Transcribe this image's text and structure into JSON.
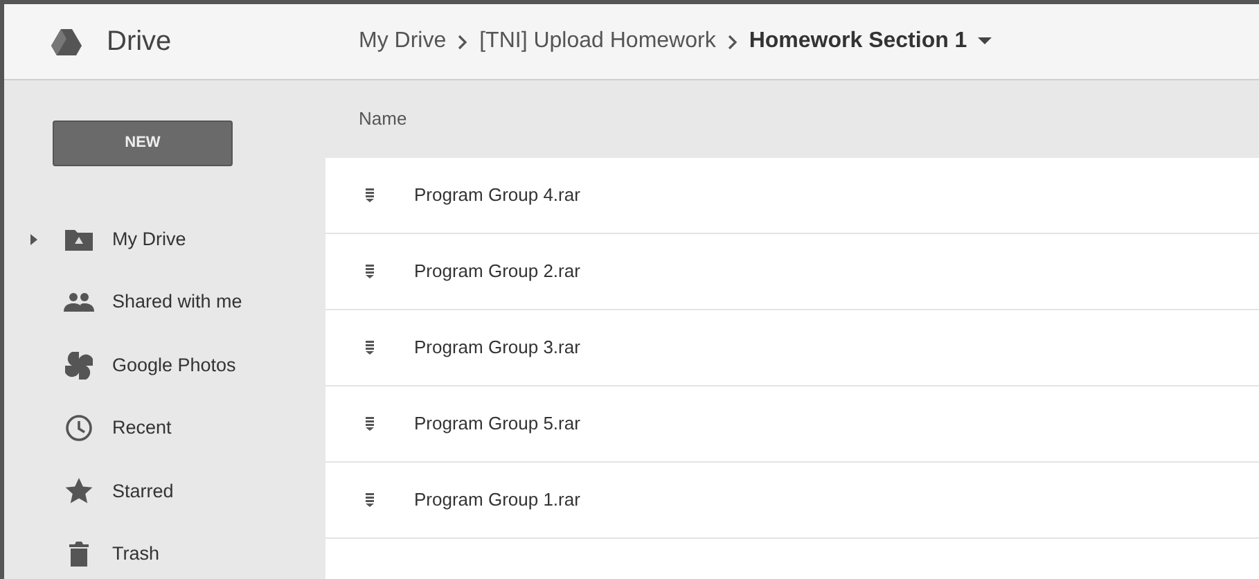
{
  "app": {
    "title": "Drive"
  },
  "breadcrumbs": [
    {
      "label": "My Drive",
      "current": false
    },
    {
      "label": "[TNI] Upload Homework",
      "current": false
    },
    {
      "label": "Homework Section 1",
      "current": true
    }
  ],
  "sidebar": {
    "new_button": "NEW",
    "items": [
      {
        "label": "My Drive"
      },
      {
        "label": "Shared with me"
      },
      {
        "label": "Google Photos"
      },
      {
        "label": "Recent"
      },
      {
        "label": "Starred"
      },
      {
        "label": "Trash"
      }
    ]
  },
  "table": {
    "columns": [
      "Name"
    ],
    "rows": [
      {
        "name": "Program Group 4.rar"
      },
      {
        "name": "Program Group 2.rar"
      },
      {
        "name": "Program Group 3.rar"
      },
      {
        "name": "Program Group 5.rar"
      },
      {
        "name": "Program Group 1.rar"
      }
    ]
  }
}
